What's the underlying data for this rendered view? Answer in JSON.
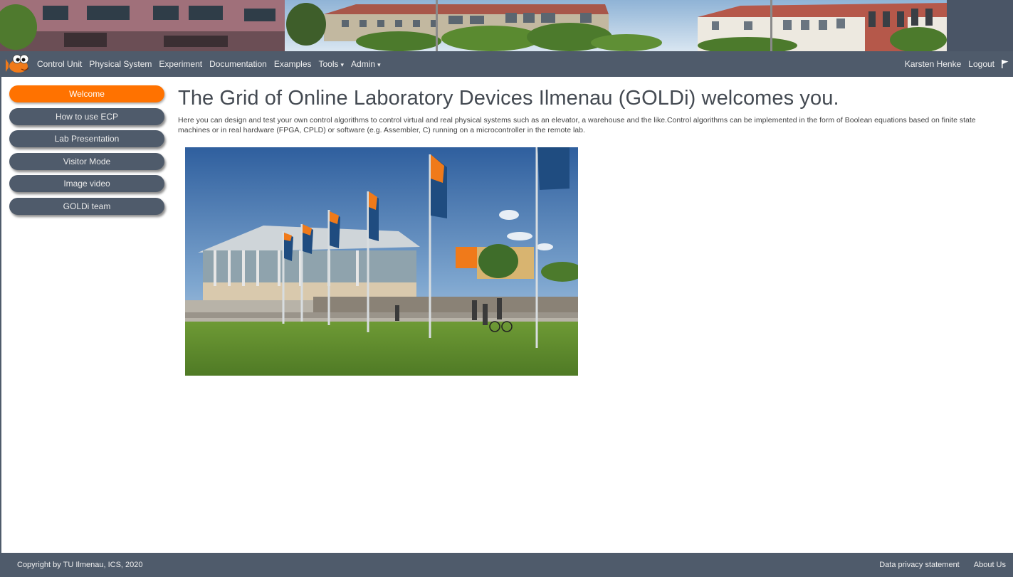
{
  "navbar": {
    "items": [
      {
        "label": "Control Unit"
      },
      {
        "label": "Physical System"
      },
      {
        "label": "Experiment"
      },
      {
        "label": "Documentation"
      },
      {
        "label": "Examples"
      },
      {
        "label": "Tools"
      },
      {
        "label": "Admin"
      }
    ],
    "user": "Karsten Henke",
    "logout": "Logout",
    "icons": {
      "logo": "goldi-fish-logo-icon",
      "flag": "flag-icon",
      "caret": "caret-down-icon"
    }
  },
  "sidebar": {
    "items": [
      {
        "label": "Welcome",
        "active": true
      },
      {
        "label": "How to use ECP"
      },
      {
        "label": "Lab Presentation"
      },
      {
        "label": "Visitor Mode"
      },
      {
        "label": "Image video"
      },
      {
        "label": "GOLDi team"
      }
    ]
  },
  "main": {
    "title": "The Grid of Online Laboratory Devices Ilmenau (GOLDi) welcomes you.",
    "intro": "Here you can design and test your own control algorithms to control virtual and real physical systems such as an elevator, a warehouse and the like.Control algorithms can be implemented in the form of Boolean equations based on finite state machines or in real hardware (FPGA, CPLD) or software (e.g. Assembler, C) running on a microcontroller in the remote lab."
  },
  "footer": {
    "copyright": "Copyright by TU Ilmenau, ICS, 2020",
    "privacy": "Data privacy statement",
    "about": "About Us"
  },
  "colors": {
    "nav_bg": "#4f5b6b",
    "accent": "#ff7200",
    "title": "#444a52"
  }
}
